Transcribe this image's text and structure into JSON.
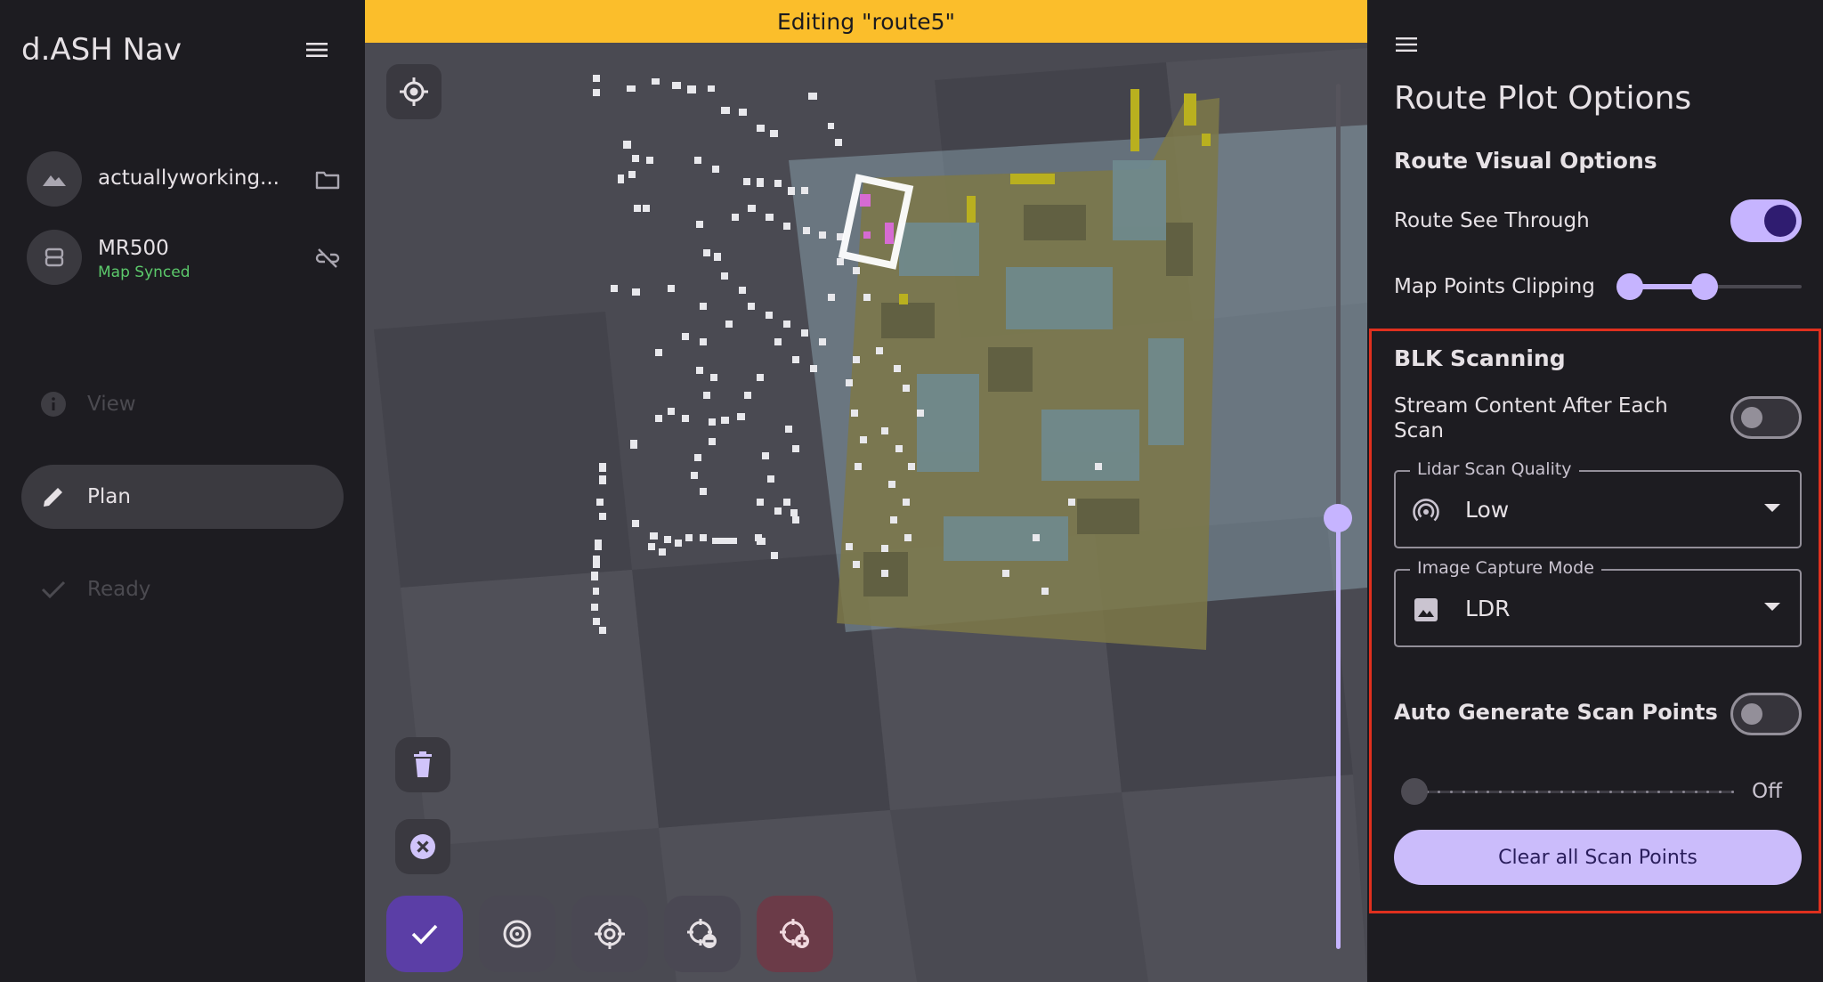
{
  "sidebar": {
    "app_title": "d.ASH Nav",
    "connections": [
      {
        "name": "actuallyworking...",
        "icon": "mountain-icon",
        "action_icon": "folder-icon"
      },
      {
        "name": "MR500",
        "status": "Map Synced",
        "status_color": "#5cc96b",
        "icon": "robot-icon",
        "action_icon": "link-off-icon"
      }
    ],
    "nav": [
      {
        "label": "View",
        "icon": "info-icon",
        "state": "disabled"
      },
      {
        "label": "Plan",
        "icon": "pencil-icon",
        "state": "active"
      },
      {
        "label": "Ready",
        "icon": "check-icon",
        "state": "disabled"
      }
    ]
  },
  "map": {
    "banner": "Editing \"route5\"",
    "banner_color": "#fbbe2b",
    "left_tools": [
      "delete-icon",
      "cancel-icon"
    ],
    "bottom_tools": [
      {
        "icon": "check-icon",
        "style": "primary"
      },
      {
        "icon": "target-icon",
        "style": "tonal"
      },
      {
        "icon": "crosshair-icon",
        "style": "tonal"
      },
      {
        "icon": "crosshair-remove-icon",
        "style": "tonal"
      },
      {
        "icon": "crosshair-add-icon",
        "style": "danger"
      }
    ],
    "zoom_level": 0.5
  },
  "panel": {
    "title": "Route Plot Options",
    "route_visual": {
      "heading": "Route Visual Options",
      "see_through_label": "Route See Through",
      "see_through_on": true,
      "clipping_label": "Map Points Clipping",
      "clipping_range": [
        0.0,
        0.4
      ]
    },
    "blk": {
      "heading": "BLK Scanning",
      "stream_label": "Stream Content After Each Scan",
      "stream_on": false,
      "lidar": {
        "label": "Lidar Scan Quality",
        "value": "Low",
        "icon": "lidar-icon"
      },
      "image": {
        "label": "Image Capture Mode",
        "value": "LDR",
        "icon": "image-icon"
      },
      "auto_label": "Auto Generate Scan Points",
      "auto_on": false,
      "auto_value": "Off",
      "clear_label": "Clear all Scan Points"
    }
  }
}
